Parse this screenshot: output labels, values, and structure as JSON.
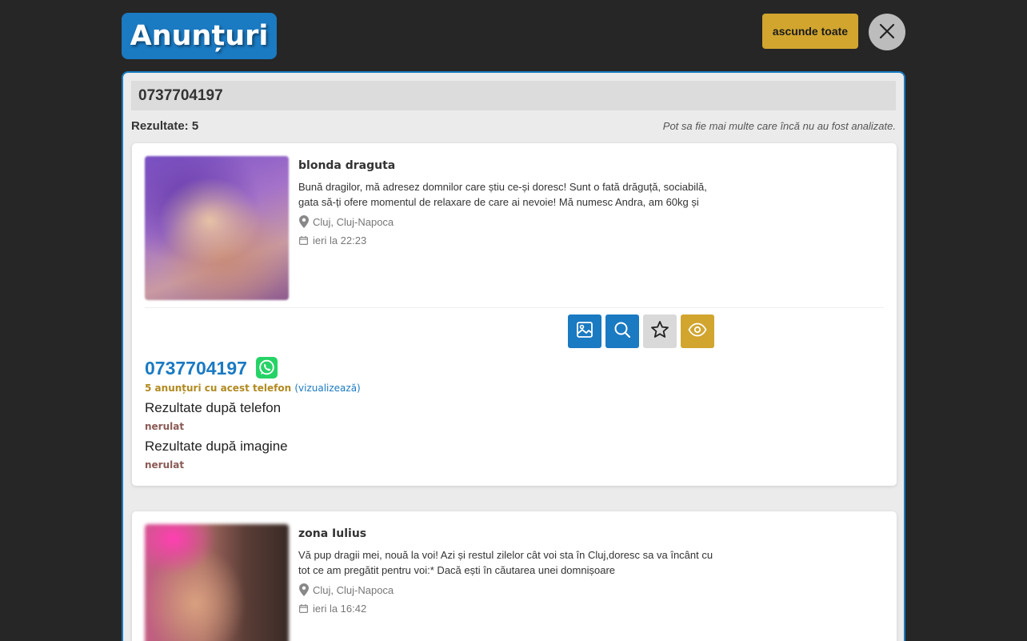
{
  "header": {
    "title": "Anunțuri",
    "hide_all_label": "ascunde toate",
    "close_icon": "close-icon"
  },
  "search": {
    "query": "0737704197",
    "results_label": "Rezultate: 5",
    "note": "Pot sa fie mai multe care încă nu au fost analizate."
  },
  "listings": [
    {
      "title": "blonda draguta",
      "description": "Bună dragilor, mă adresez domnilor care știu ce-și doresc! Sunt o fată drăguță, sociabilă, gata să-ți ofere momentul de relaxare de care ai nevoie! Mă numesc Andra, am 60kg și",
      "location": "Cluj, Cluj-Napoca",
      "date": "ieri la 22:23",
      "phone": "0737704197",
      "ads_count": "5",
      "ads_text": "anunțuri cu acest telefon",
      "ads_view": "(vizualizează)",
      "phone_results_title": "Rezultate după telefon",
      "phone_results_status": "nerulat",
      "image_results_title": "Rezultate după imagine",
      "image_results_status": "nerulat"
    },
    {
      "title": "zona Iulius",
      "description": "Vă pup dragii mei, nouă la voi! Azi și restul zilelor cât voi sta în Cluj,doresc sa va încânt cu tot ce am pregătit pentru voi:* Dacă ești în căutarea unei domnișoare",
      "location": "Cluj, Cluj-Napoca",
      "date": "ieri la 16:42"
    }
  ],
  "actions": [
    "image-icon",
    "search-icon",
    "star-icon",
    "eye-icon"
  ],
  "colors": {
    "accent_blue": "#1a7ac2",
    "accent_gold": "#d1a52e",
    "background": "#262626",
    "whatsapp_green": "#25d366"
  }
}
